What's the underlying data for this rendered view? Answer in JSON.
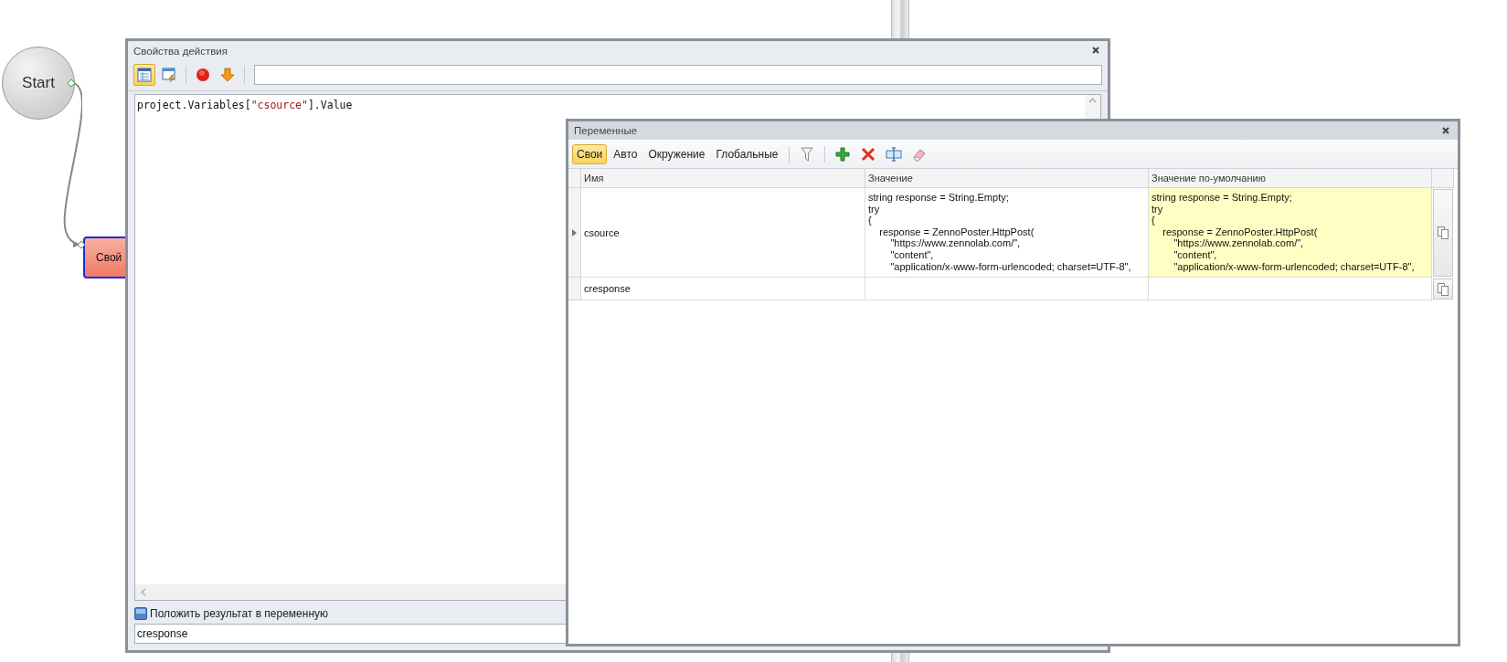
{
  "diagram": {
    "start_node": {
      "label": "Start"
    },
    "action_node": {
      "label": "Свой"
    }
  },
  "properties_window": {
    "title": "Свойства действия",
    "toolbar": [
      {
        "kind": "table",
        "pressed": true
      },
      {
        "kind": "window",
        "pressed": false
      },
      {
        "kind": "stop",
        "pressed": false
      },
      {
        "kind": "down",
        "pressed": false
      }
    ],
    "code": [
      {
        "kind": "plain",
        "text": "project.Variables["
      },
      {
        "kind": "string",
        "text": "\"csource\""
      },
      {
        "kind": "plain",
        "text": "].Value"
      }
    ],
    "save_result": {
      "label": "Положить результат в переменную"
    },
    "result_variable": {
      "value": "cresponse"
    }
  },
  "variables_window": {
    "title": "Переменные",
    "tabs": [
      {
        "label": "Свои",
        "selected": true
      },
      {
        "label": "Авто",
        "selected": false
      },
      {
        "label": "Окружение",
        "selected": false
      },
      {
        "label": "Глобальные",
        "selected": false
      }
    ],
    "columns": [
      "Имя",
      "Значение",
      "Значение по-умолчанию"
    ],
    "rows": [
      {
        "name": "csource",
        "current": true,
        "default_highlighted": true,
        "value": "string response = String.Empty;\ntry\n{\n    response = ZennoPoster.HttpPost(\n        \"https://www.zennolab.com/\",\n        \"content\",\n        \"application/x-www-form-urlencoded; charset=UTF-8\",",
        "default": "string response = String.Empty;\ntry\n{\n    response = ZennoPoster.HttpPost(\n        \"https://www.zennolab.com/\",\n        \"content\",\n        \"application/x-www-form-urlencoded; charset=UTF-8\","
      },
      {
        "name": "cresponse",
        "current": false,
        "default_highlighted": false,
        "value": "",
        "default": ""
      }
    ]
  }
}
